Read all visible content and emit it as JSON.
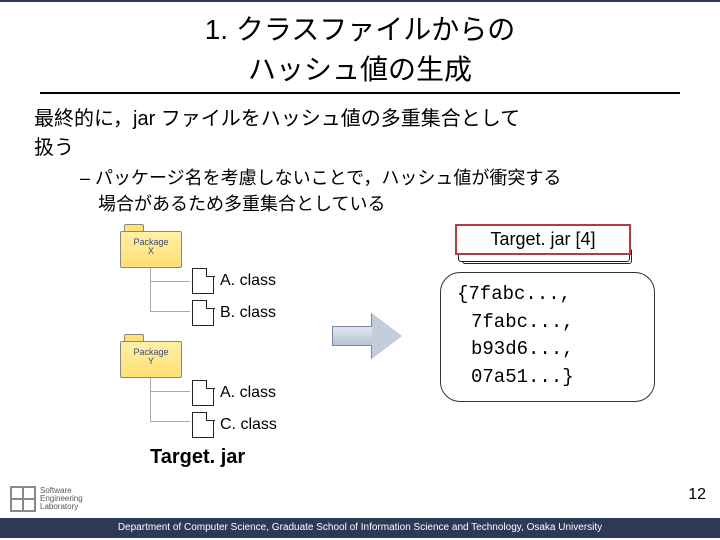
{
  "title_line1": "1. クラスファイルからの",
  "title_line2": "ハッシュ値の生成",
  "body_line1": " 最終的に，jar ファイルをハッシュ値の多重集合として",
  "body_line2": "扱う",
  "sub_bullet_line1": "– パッケージ名を考慮しないことで，ハッシュ値が衝突する",
  "sub_bullet_line2": "場合があるため多重集合としている",
  "packageX": "Package\nX",
  "packageY": "Package\nY",
  "files": {
    "x_a": "A. class",
    "x_b": "B. class",
    "y_a": "A. class",
    "y_c": "C. class"
  },
  "target_title": "Target. jar [4]",
  "hashes": {
    "open": "{",
    "h1": "7fabc...,",
    "h2": "7fabc...,",
    "h3": "b93d6...,",
    "h4": "07a51...}",
    "close": ""
  },
  "target_jar_label": "Target. jar",
  "slide_number": "12",
  "footer": "Department of Computer Science, Graduate School of Information Science and Technology, Osaka University",
  "logo_text": "Software\nEngineering\nLaboratory"
}
